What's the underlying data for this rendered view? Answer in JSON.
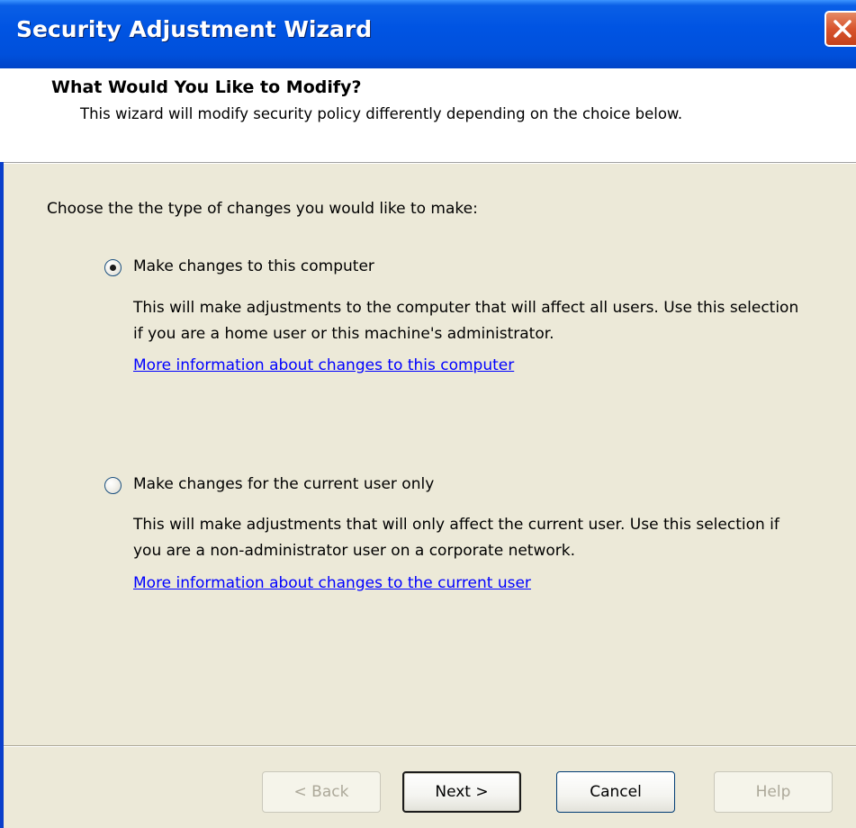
{
  "window": {
    "title": "Security Adjustment Wizard",
    "close_icon": "close-icon"
  },
  "header": {
    "title": "What Would You Like to Modify?",
    "description": "This wizard will modify security policy differently depending on the choice below."
  },
  "main": {
    "prompt": "Choose the the type of changes you would like to make:",
    "options": [
      {
        "label": "Make changes to this computer",
        "selected": true,
        "description": "This will make adjustments to the computer that will affect all users.  Use this selection if you are a home user or this machine's administrator.",
        "link": "More information about changes to this computer"
      },
      {
        "label": "Make changes for the current user only",
        "selected": false,
        "description": "This will make adjustments that will only affect the current user.  Use this selection if you are a non-administrator user on a corporate network.",
        "link": "More information about changes to the current user"
      }
    ]
  },
  "buttons": {
    "back": "< Back",
    "next": "Next >",
    "cancel": "Cancel",
    "help": "Help"
  },
  "colors": {
    "titlebar": "#0054E3",
    "dialog_bg": "#ECE9D8",
    "link": "#0000FF",
    "close_button": "#D8542D"
  }
}
